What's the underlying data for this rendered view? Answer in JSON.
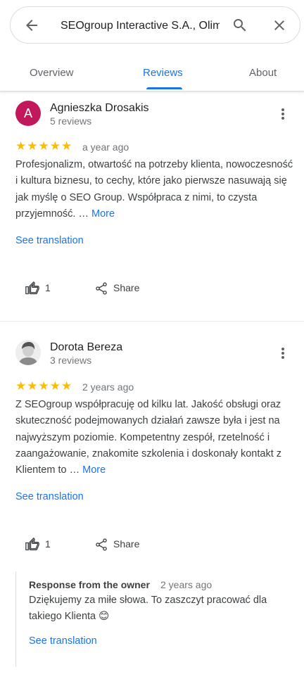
{
  "search": {
    "query": "SEOgroup Interactive S.A., Olim"
  },
  "tabs": [
    {
      "label": "Overview"
    },
    {
      "label": "Reviews"
    },
    {
      "label": "About"
    }
  ],
  "reviews": [
    {
      "avatar_letter": "A",
      "name": "Agnieszka Drosakis",
      "count": "5 reviews",
      "stars": "★★★★★",
      "rating": 5,
      "when": "a year ago",
      "text": "Profesjonalizm, otwartość na potrzeby klienta, nowoczesność i kultura biznesu, to cechy, które jako pierwsze nasuwają się jak myślę o SEO Group. Współpraca z nimi, to czysta przyjemność. …",
      "more": "More",
      "translate": "See translation",
      "likes": "1",
      "share": "Share"
    },
    {
      "name": "Dorota Bereza",
      "count": "3 reviews",
      "stars": "★★★★★",
      "rating": 5,
      "when": "2 years ago",
      "text": "Z SEOgroup współpracuję od kilku lat.  Jakość obsługi oraz skuteczność podejmowanych działań zawsze była i jest na najwyższym poziomie. Kompetentny zespół, rzetelność i zaangażowanie, znakomite szkolenia i doskonały kontakt z Klientem to …",
      "more": "More",
      "translate": "See translation",
      "likes": "1",
      "share": "Share",
      "owner_response": {
        "title": "Response from the owner",
        "when": "2 years ago",
        "text": "Dziękujemy za miłe słowa. To zaszczyt pracować dla takiego Klienta 😊",
        "translate": "See translation"
      }
    }
  ],
  "colors": {
    "accent": "#1a73e8",
    "star": "#fbbc04",
    "avatar_a": "#c2185b"
  },
  "icons": [
    "arrow-back-icon",
    "search-icon",
    "close-icon",
    "more-vert-icon",
    "thumb-up-icon",
    "share-icon",
    "star-icon"
  ]
}
